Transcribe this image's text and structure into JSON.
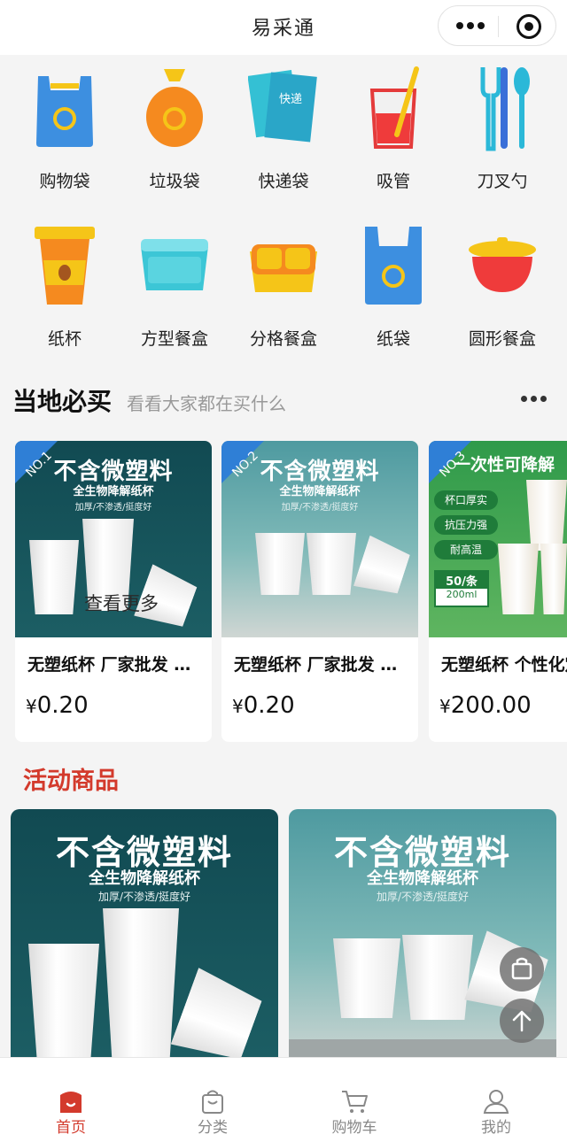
{
  "app": {
    "title": "易采通"
  },
  "categories": [
    {
      "label": "购物袋",
      "icon": "shopping-bag-icon"
    },
    {
      "label": "垃圾袋",
      "icon": "garbage-bag-icon"
    },
    {
      "label": "快递袋",
      "icon": "express-bag-icon"
    },
    {
      "label": "吸管",
      "icon": "straw-icon"
    },
    {
      "label": "刀叉勺",
      "icon": "cutlery-icon"
    },
    {
      "label": "纸杯",
      "icon": "paper-cup-icon"
    },
    {
      "label": "方型餐盒",
      "icon": "square-box-icon"
    },
    {
      "label": "分格餐盒",
      "icon": "compartment-box-icon"
    },
    {
      "label": "纸袋",
      "icon": "paper-bag-icon"
    },
    {
      "label": "圆形餐盒",
      "icon": "round-box-icon"
    }
  ],
  "category_icon_texts": {
    "express_bag": "快递"
  },
  "local_section": {
    "title": "当地必买",
    "subtitle": "看看大家都在买什么",
    "more_overlay": "查看更多",
    "products": [
      {
        "rank": "NO.1",
        "name": "无塑纸杯 厂家批发 批量定制",
        "currency": "¥",
        "price": "0.20",
        "image_headline": "不含微塑料",
        "image_sub": "全生物降解纸杯",
        "image_note": "加厚/不渗透/挺度好"
      },
      {
        "rank": "NO.2",
        "name": "无塑纸杯 厂家批发 批量定制",
        "currency": "¥",
        "price": "0.20",
        "image_headline": "不含微塑料",
        "image_sub": "全生物降解纸杯",
        "image_note": "加厚/不渗透/挺度好"
      },
      {
        "rank": "NO.3",
        "name": "无塑纸杯 个性化定制",
        "currency": "¥",
        "price": "200.00",
        "image_headline": "一次性可降解",
        "image_features": [
          "杯口厚实",
          "抗压力强",
          "耐高温"
        ],
        "image_pack": "50/条",
        "image_volume": "200ml"
      }
    ]
  },
  "activity_section": {
    "title": "活动商品",
    "items": [
      {
        "image_headline": "不含微塑料",
        "image_sub": "全生物降解纸杯",
        "image_note": "加厚/不渗透/挺度好"
      },
      {
        "image_headline": "不含微塑料",
        "image_sub": "全生物降解纸杯",
        "image_note": "加厚/不渗透/挺度好"
      }
    ]
  },
  "floating_buttons": [
    {
      "icon": "cart-bag-icon"
    },
    {
      "icon": "arrow-up-icon"
    }
  ],
  "tabbar": [
    {
      "label": "首页",
      "icon": "home-icon",
      "active": true
    },
    {
      "label": "分类",
      "icon": "category-bag-icon",
      "active": false
    },
    {
      "label": "购物车",
      "icon": "cart-icon",
      "active": false
    },
    {
      "label": "我的",
      "icon": "user-icon",
      "active": false
    }
  ],
  "colors": {
    "accent_red": "#d33a2c",
    "teal_dark": "#114a52",
    "teal_light": "#4e9aa0",
    "green_banner": "#2f9a4a",
    "badge_blue": "#2f7fd6"
  }
}
